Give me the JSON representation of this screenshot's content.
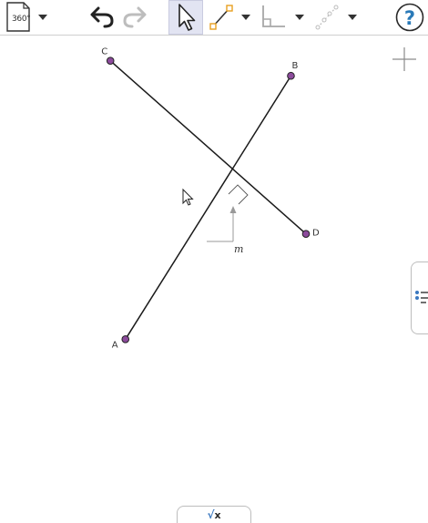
{
  "toolbar": {
    "file_label": "360°",
    "help_label": "?"
  },
  "construction": {
    "points": [
      {
        "name": "C",
        "x": -2.9,
        "y": 3.3
      },
      {
        "name": "B",
        "x": 1.9,
        "y": 2.9
      },
      {
        "name": "D",
        "x": 2.3,
        "y": -1.3
      },
      {
        "name": "A",
        "x": -2.5,
        "y": -4.1
      }
    ],
    "segments": [
      "CD",
      "AB"
    ],
    "line_label": "m"
  },
  "algebra_toggle": {
    "label": "x",
    "symbol": "√"
  },
  "colors": {
    "point_fill": "#8c4b9c",
    "segment": "#1a1a1a",
    "active_tool_bg": "#e2e4f2",
    "help_blue": "#2a7ab8"
  }
}
